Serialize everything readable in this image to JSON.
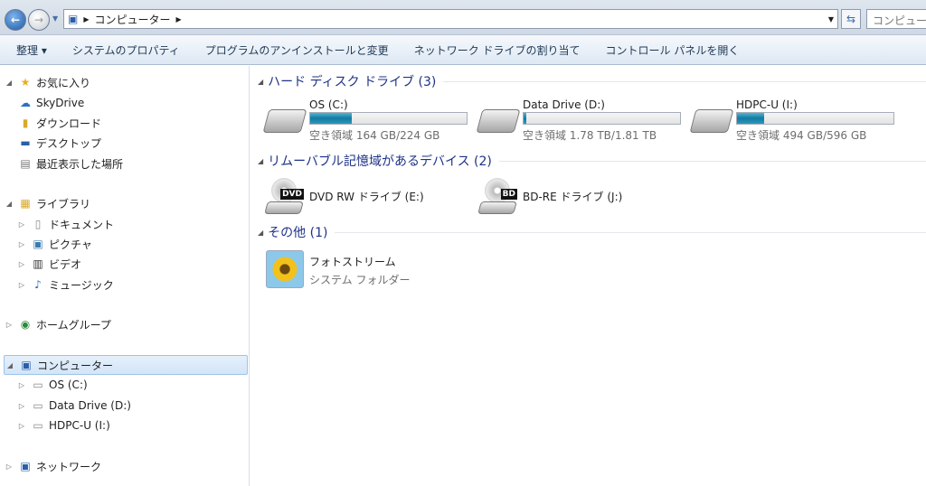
{
  "address": {
    "path": [
      "コンピューター"
    ],
    "search_placeholder": "コンピューター の検索"
  },
  "toolbar": {
    "items": [
      "整理 ▾",
      "システムのプロパティ",
      "プログラムのアンインストールと変更",
      "ネットワーク ドライブの割り当て",
      "コントロール パネルを開く"
    ]
  },
  "sidebar": {
    "favorites": "お気に入り",
    "fav_items": [
      "SkyDrive",
      "ダウンロード",
      "デスクトップ",
      "最近表示した場所"
    ],
    "libraries": "ライブラリ",
    "lib_items": [
      "ドキュメント",
      "ピクチャ",
      "ビデオ",
      "ミュージック"
    ],
    "homegroup": "ホームグループ",
    "computer": "コンピューター",
    "comp_items": [
      "OS (C:)",
      "Data Drive (D:)",
      "HDPC-U (I:)"
    ],
    "network": "ネットワーク"
  },
  "groups": {
    "hdd": "ハード ディスク ドライブ (3)",
    "removable": "リムーバブル記憶域があるデバイス (2)",
    "other": "その他 (1)"
  },
  "drives": [
    {
      "name": "OS (C:)",
      "free": "空き領域 164 GB/224 GB",
      "used_percent": 26.8
    },
    {
      "name": "Data Drive (D:)",
      "free": "空き領域 1.78 TB/1.81 TB",
      "used_percent": 1.7
    },
    {
      "name": "HDPC-U (I:)",
      "free": "空き領域 494 GB/596 GB",
      "used_percent": 17.1
    }
  ],
  "removable": [
    {
      "name": "DVD RW ドライブ (E:)",
      "badge": "DVD"
    },
    {
      "name": "BD-RE ドライブ (J:)",
      "badge": "BD"
    }
  ],
  "other": {
    "name": "フォトストリーム",
    "sub": "システム フォルダー"
  }
}
